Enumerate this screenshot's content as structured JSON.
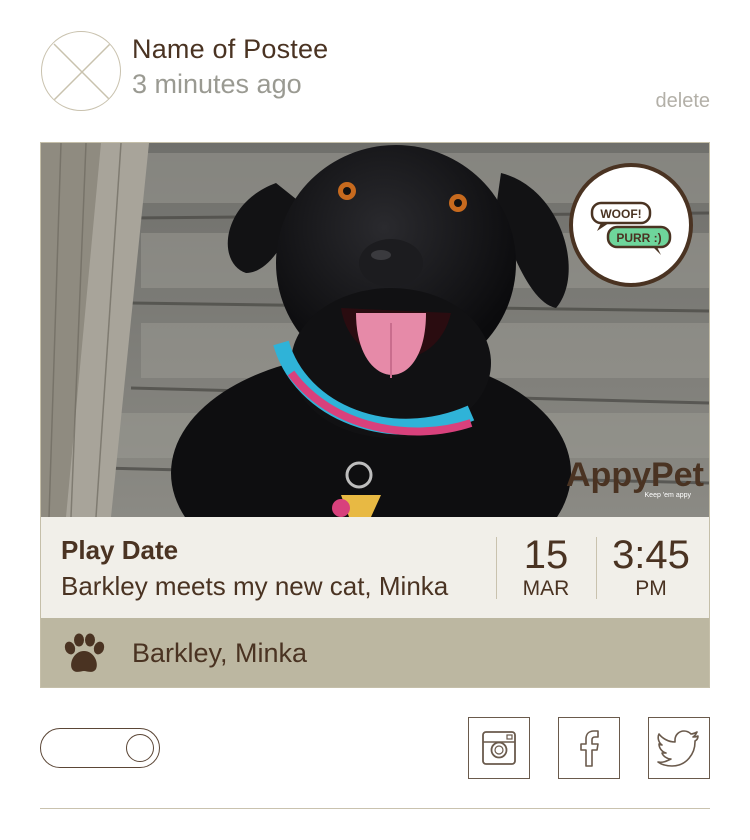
{
  "post": {
    "poster_name": "Name of Postee",
    "time_ago": "3 minutes ago",
    "delete_label": "delete"
  },
  "card": {
    "badge": {
      "woof": "WOOF!",
      "purr": "PURR :)"
    },
    "brand": {
      "name": "AppyPet",
      "tagline": "Keep 'em appy"
    },
    "event": {
      "title": "Play Date",
      "description": "Barkley meets my new cat, Minka",
      "day": "15",
      "month": "MAR",
      "time": "3:45",
      "ampm": "PM"
    },
    "tags": "Barkley, Minka"
  },
  "colors": {
    "brand_brown": "#4a3322",
    "tag_bar": "#bcb7a1",
    "info_bg": "#f1efe9",
    "badge_green": "#6ed59b"
  },
  "icons": {
    "avatar": "avatar-placeholder-x-icon",
    "paw": "paw-icon",
    "share": [
      "instagram-icon",
      "facebook-icon",
      "twitter-icon"
    ]
  }
}
